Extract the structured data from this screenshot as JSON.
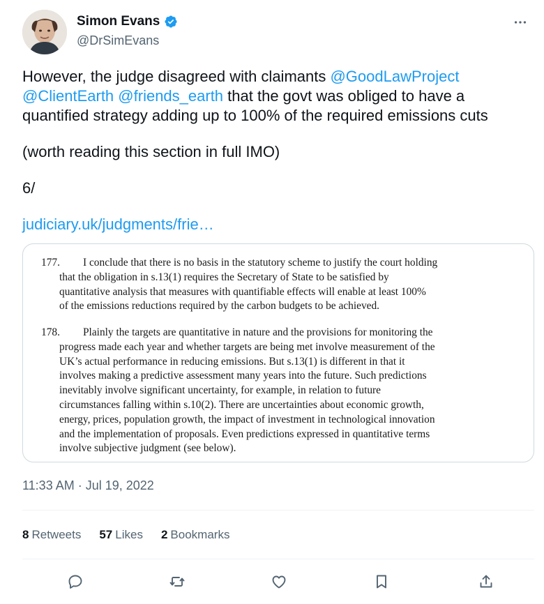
{
  "author": {
    "name": "Simon Evans",
    "handle": "@DrSimEvans",
    "verified_color": "#1d9bf0"
  },
  "tweet": {
    "line1_prefix": "However, the judge disagreed with claimants ",
    "mention1": "@GoodLawProject",
    "mention2": "@ClientEarth",
    "mention3": "@friends_earth",
    "line2_suffix": " that the govt was obliged to have a",
    "line3": "quantified strategy adding up to 100% of the required emissions cuts",
    "line4": "(worth reading this section in full IMO)",
    "line5": "6/",
    "link": "judiciary.uk/judgments/frie…"
  },
  "document": {
    "para177_num": "177.",
    "para177_lines": [
      "I conclude that there is no basis in the statutory scheme to justify the court holding",
      "that the obligation in s.13(1) requires the Secretary of State to be satisfied by",
      "quantitative analysis that measures with quantifiable effects will enable at least 100%",
      "of the emissions reductions required by the carbon budgets to be achieved."
    ],
    "para178_num": "178.",
    "para178_lines": [
      "Plainly the targets are quantitative in nature and the provisions for monitoring the",
      "progress made each year and whether targets are being met involve measurement of the",
      "UK’s actual performance in reducing emissions. But s.13(1) is different in that it",
      "involves making a predictive assessment many years into the future. Such predictions",
      "inevitably involve significant uncertainty, for example, in relation to future",
      "circumstances falling within s.10(2). There are uncertainties about economic growth,",
      "energy, prices, population growth, the impact of investment in technological innovation",
      "and the implementation of proposals. Even predictions expressed in quantitative terms",
      "involve subjective judgment (see below)."
    ]
  },
  "meta": {
    "timestamp": "11:33 AM · Jul 19, 2022",
    "retweets_count": "8",
    "retweets_label": "Retweets",
    "likes_count": "57",
    "likes_label": "Likes",
    "bookmarks_count": "2",
    "bookmarks_label": "Bookmarks"
  },
  "icons": {
    "more": "more-horizontal-icon",
    "reply": "reply-icon",
    "retweet": "retweet-icon",
    "like": "heart-icon",
    "bookmark": "bookmark-icon",
    "share": "share-icon"
  }
}
